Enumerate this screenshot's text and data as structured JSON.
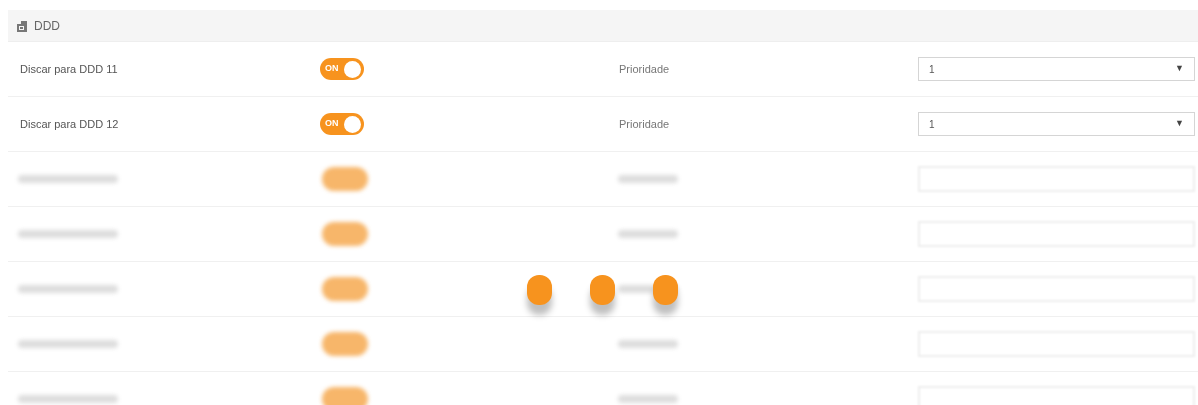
{
  "section": {
    "title": "DDD"
  },
  "rows": [
    {
      "kind": "setting",
      "label": "Discar para DDD 11",
      "on": true,
      "on_text": "ON",
      "priority_label": "Prioridade",
      "priority_value": "1",
      "arrow": "▼"
    },
    {
      "kind": "setting",
      "label": "Discar para DDD 12",
      "on": true,
      "on_text": "ON",
      "priority_label": "Prioridade",
      "priority_value": "1",
      "arrow": "▼"
    },
    {
      "kind": "blurred",
      "on": true
    },
    {
      "kind": "blurred",
      "on": true
    },
    {
      "kind": "blurred",
      "on": true
    },
    {
      "kind": "blurred",
      "on": true
    },
    {
      "kind": "blurred",
      "on": true
    }
  ],
  "loading": true
}
